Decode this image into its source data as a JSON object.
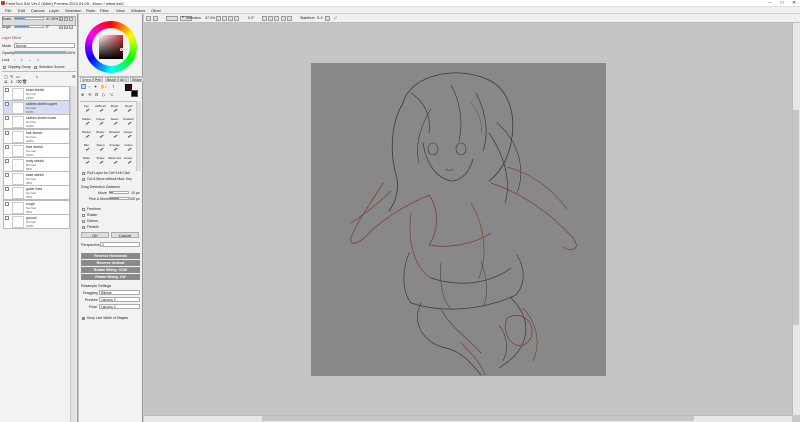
{
  "window": {
    "title": "PaintTool SAI Ver.2 (64bit) Preview.2023.04.05 - Mono / wtest.sai2",
    "controls": [
      "–",
      "□",
      "✕"
    ]
  },
  "menu": [
    "File",
    "Edit",
    "Canvas",
    "Layer",
    "Selection",
    "Ruler",
    "Filter",
    "View",
    "Window",
    "Other"
  ],
  "navigator": {
    "scale_label": "Scale",
    "scale_value": "37.30%",
    "angle_label": "Angle",
    "angle_value": "0°"
  },
  "layer_effect": {
    "header": "Layer Effect",
    "mode_label": "Mode",
    "mode_value": "Normal",
    "opacity_label": "Opacity",
    "opacity_value": "100%",
    "lock_label": "Lock",
    "clipping_label": "Clipping Group",
    "selection_source_label": "Selection Source"
  },
  "layers": [
    {
      "name": "head sketch",
      "mode": "Normal",
      "opacity": "100%",
      "selected": false
    },
    {
      "name": "clothes sketch upper",
      "mode": "Normal",
      "opacity": "100%",
      "selected": true
    },
    {
      "name": "clothes sketch lower",
      "mode": "Normal",
      "opacity": "100%",
      "selected": false
    },
    {
      "name": "hair sketch",
      "mode": "Normal",
      "opacity": "100%",
      "selected": false
    },
    {
      "name": "face sketch",
      "mode": "Normal",
      "opacity": "100%",
      "selected": false
    },
    {
      "name": "body sketch",
      "mode": "Normal",
      "opacity": "35%",
      "selected": false
    },
    {
      "name": "base sketch",
      "mode": "Normal",
      "opacity": "35%",
      "selected": false
    },
    {
      "name": "guide lines",
      "mode": "Normal",
      "opacity": "35%",
      "selected": false
    },
    {
      "name": "rough",
      "mode": "Normal",
      "opacity": "35%",
      "selected": false
    },
    {
      "name": "ground",
      "mode": "Normal",
      "opacity": "100%",
      "selected": false
    }
  ],
  "color": {
    "primary": "#3a0c0c",
    "secondary": "#ffffff"
  },
  "tool_tabs": [
    "Select",
    "Pen",
    "Brush",
    "Air 1",
    "Shape"
  ],
  "tools": [
    [
      "Pen",
      "AirBrush",
      "Brush",
      "Pencil"
    ],
    [
      "Marker",
      "Crayon",
      "Select",
      "Gradient"
    ],
    [
      "Bucket",
      "Binary",
      "Deselect",
      "Eraser"
    ],
    [
      "Blur",
      "Stamp",
      "Smudge",
      "Colour"
    ],
    [
      "Water",
      "Shape",
      "Watercolor",
      "Eraser"
    ]
  ],
  "tool_options": {
    "pick_layers": "Pick Layer for Ctrl+Left Click",
    "cut_move": "Cut & Move without Mod. Key",
    "drag_detection": "Drag Detection Distance",
    "move_label": "Move",
    "move_value": "10 px",
    "pick_move_label": "Pick & Move",
    "pick_move_value": "100 px",
    "checks": [
      "Freeform",
      "Rotate",
      "Deform",
      "Flexible"
    ],
    "ok_label": "OK",
    "cancel_label": "Cancel",
    "perspective_label": "Perspective",
    "perspective_value": "0",
    "buttons": [
      "Reverse Horizontal",
      "Reverse Vertical",
      "Rotate 90deg. CCW",
      "Rotate 90deg. CW"
    ],
    "resample_header": "Resample Settings",
    "resample": [
      {
        "label": "Dragging",
        "value": "Bilinear"
      },
      {
        "label": "Preview",
        "value": "Lanczos 3"
      },
      {
        "label": "Final",
        "value": "Lanczos 3"
      }
    ],
    "keep_line_width": "Keep Line Width of Shapes"
  },
  "toolbar": {
    "selection_label": "Selection",
    "zoom_value": "37.3%",
    "angle_value": "0.0°",
    "stabilizer_label": "Stabilizer",
    "stabilizer_value": "S-3"
  }
}
